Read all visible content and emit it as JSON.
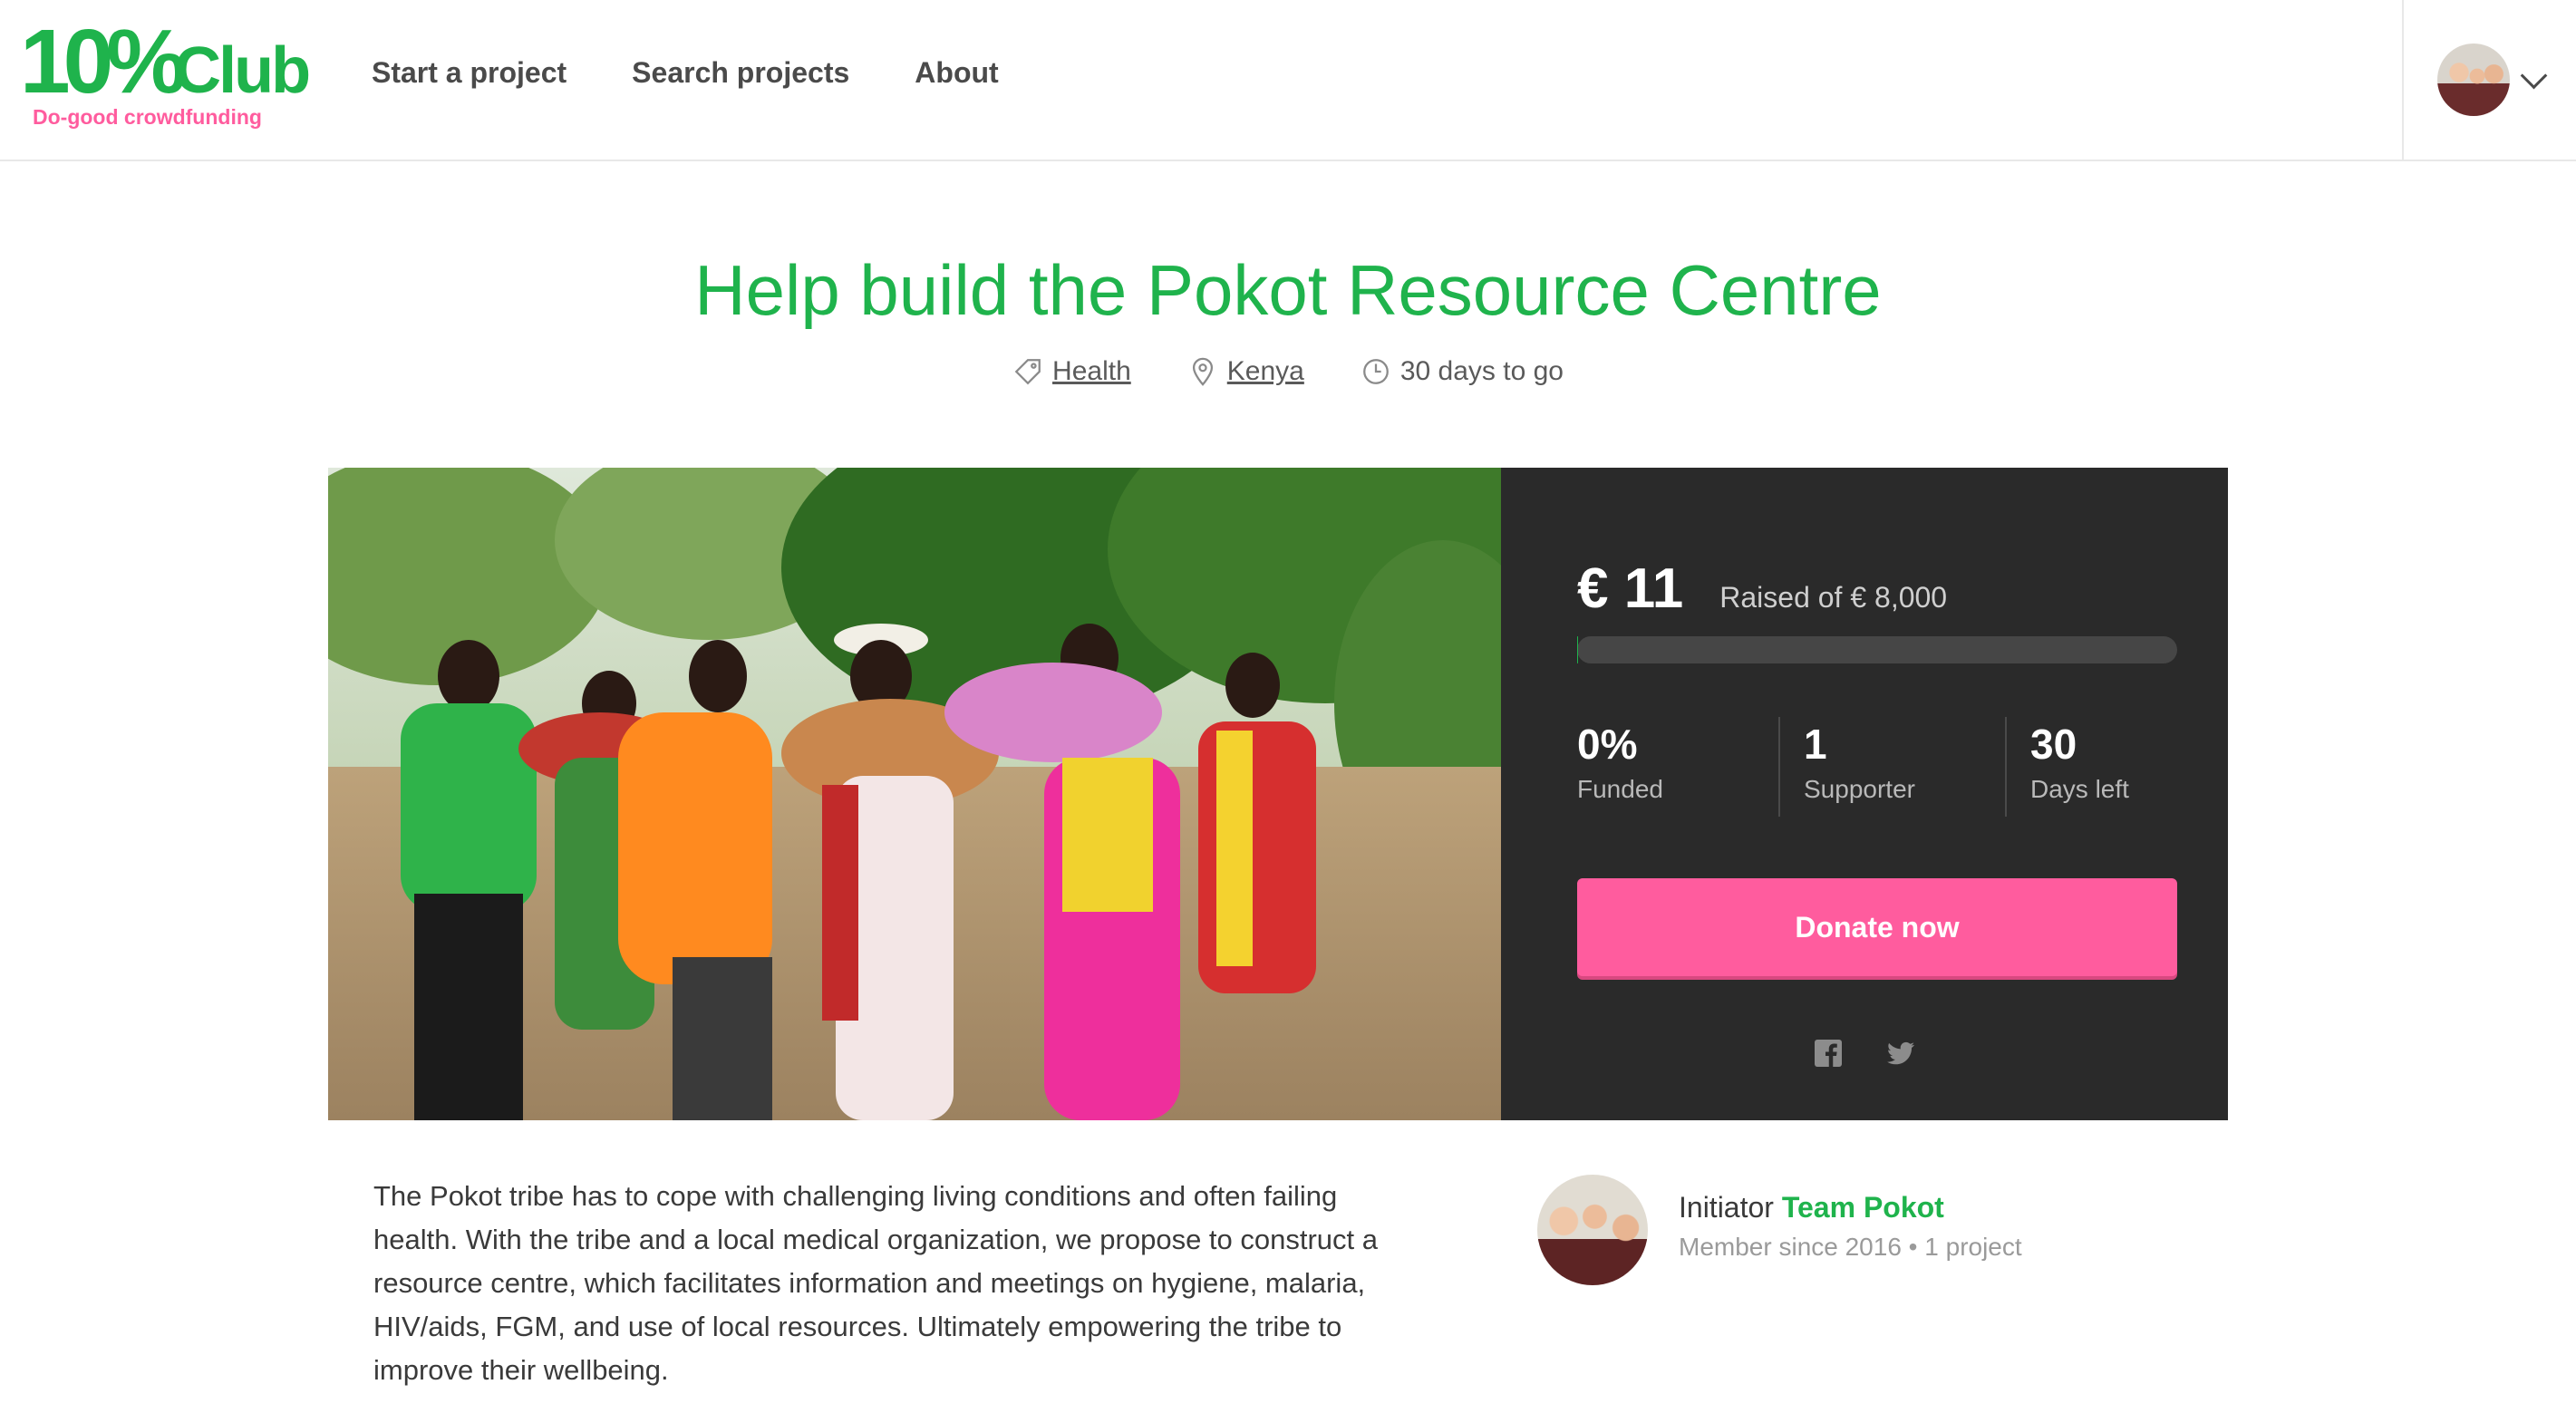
{
  "brand": {
    "logo_text": "10%Club",
    "tagline": "Do-good crowdfunding",
    "colors": {
      "green": "#1fb34c",
      "pink": "#ff5c9e",
      "panel": "#2a2a2a"
    }
  },
  "nav": {
    "items": [
      {
        "label": "Start a project"
      },
      {
        "label": "Search projects"
      },
      {
        "label": "About"
      }
    ]
  },
  "user_menu": {
    "icon": "chevron-down-icon"
  },
  "project": {
    "title": "Help build the Pokot Resource Centre",
    "theme": "Health",
    "country": "Kenya",
    "time_left": "30 days to go",
    "image_alt_icon": "project-photo"
  },
  "funding": {
    "amount": "€ 11",
    "raised_of": "Raised of € 8,000",
    "progress_fraction": 0.0014,
    "stats": [
      {
        "value": "0%",
        "label": "Funded"
      },
      {
        "value": "1",
        "label": "Supporter"
      },
      {
        "value": "30",
        "label": "Days left"
      }
    ],
    "donate_label": "Donate now",
    "share_icons": [
      "facebook-icon",
      "twitter-icon"
    ]
  },
  "description": "The Pokot tribe has to cope with challenging living conditions and often failing health. With the tribe and a local medical organization, we propose to construct a resource centre, which facilitates information and meetings on hygiene, malaria, HIV/aids, FGM, and use of local resources. Ultimately empowering the tribe to improve their wellbeing.",
  "initiator": {
    "prefix": "Initiator",
    "name": "Team Pokot",
    "sub": "Member since 2016 • 1 project"
  }
}
